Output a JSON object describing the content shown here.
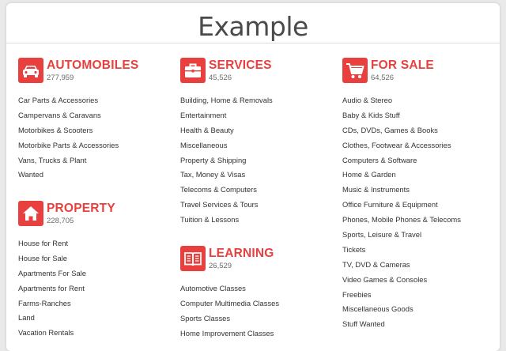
{
  "header": {
    "title": "Example"
  },
  "colors": {
    "accent": "#e8403f",
    "text": "#333333",
    "muted": "#6a6a6a"
  },
  "categories": {
    "automobiles": {
      "icon": "car-icon",
      "title": "AUTOMOBILES",
      "count": "277,959",
      "links": [
        "Car Parts & Accessories",
        "Campervans & Caravans",
        "Motorbikes & Scooters",
        "Motorbike Parts & Accessories",
        "Vans, Trucks & Plant",
        "Wanted"
      ]
    },
    "property": {
      "icon": "home-icon",
      "title": "PROPERTY",
      "count": "228,705",
      "links": [
        "House for Rent",
        "House for Sale",
        "Apartments For Sale",
        "Apartments for Rent",
        "Farms-Ranches",
        "Land",
        "Vacation Rentals"
      ]
    },
    "services": {
      "icon": "briefcase-icon",
      "title": "SERVICES",
      "count": "45,526",
      "links": [
        "Building, Home & Removals",
        "Entertainment",
        "Health & Beauty",
        "Miscellaneous",
        "Property & Shipping",
        "Tax, Money & Visas",
        "Telecoms & Computers",
        "Travel Services & Tours",
        "Tuition & Lessons"
      ]
    },
    "learning": {
      "icon": "book-icon",
      "title": "LEARNING",
      "count": "26,529",
      "links": [
        "Automotive Classes",
        "Computer Multimedia Classes",
        "Sports Classes",
        "Home Improvement Classes"
      ]
    },
    "forsale": {
      "icon": "shopping-cart-icon",
      "title": "FOR SALE",
      "count": "64,526",
      "links": [
        "Audio & Stereo",
        "Baby & Kids Stuff",
        "CDs, DVDs, Games & Books",
        "Clothes, Footwear & Accessories",
        "Computers & Software",
        "Home & Garden",
        "Music & Instruments",
        "Office Furniture & Equipment",
        "Phones, Mobile Phones & Telecoms",
        "Sports, Leisure & Travel",
        "Tickets",
        "TV, DVD & Cameras",
        "Video Games & Consoles",
        "Freebies",
        "Miscellaneous Goods",
        "Stuff Wanted"
      ]
    }
  }
}
